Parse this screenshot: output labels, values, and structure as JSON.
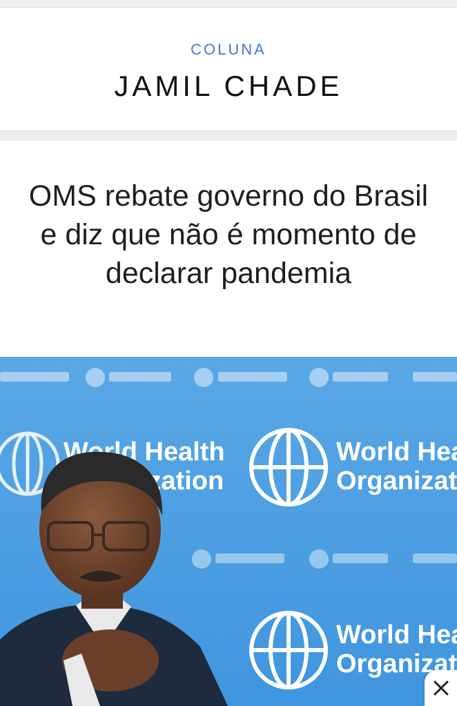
{
  "column": {
    "kicker": "COLUNA",
    "author": "JAMIL CHADE"
  },
  "article": {
    "headline": "OMS rebate governo do Brasil e diz que não é momento de declarar pandemia"
  },
  "photo": {
    "backdrop": {
      "line1": "World Health",
      "line2": "Organization",
      "partial1": "World Hea",
      "partial2": "Organizati"
    }
  },
  "icons": {
    "close": "close-icon",
    "emblem": "who-emblem-icon"
  },
  "colors": {
    "kicker": "#4a74d6",
    "backdrop_blue": "#4aa3e6",
    "backdrop_text": "#ffffff"
  }
}
